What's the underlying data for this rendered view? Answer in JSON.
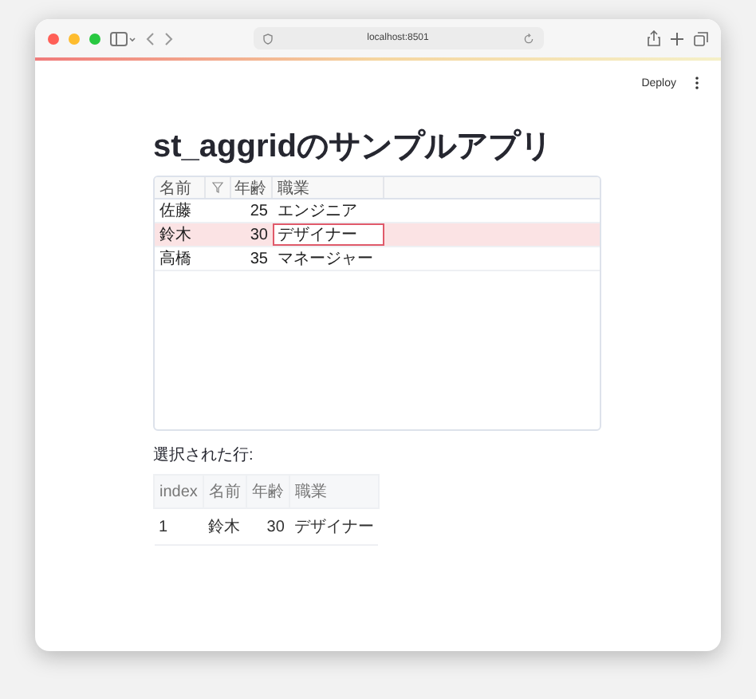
{
  "browser": {
    "url": "localhost:8501"
  },
  "header": {
    "deploy": "Deploy"
  },
  "title": "st_aggridのサンプルアプリ",
  "grid": {
    "columns": [
      "名前",
      "年齢",
      "職業"
    ],
    "rows": [
      {
        "name": "佐藤",
        "age": "25",
        "job": "エンジニア",
        "selected": false,
        "focused": false
      },
      {
        "name": "鈴木",
        "age": "30",
        "job": "デザイナー",
        "selected": true,
        "focused": true
      },
      {
        "name": "高橋",
        "age": "35",
        "job": "マネージャー",
        "selected": false,
        "focused": false
      }
    ]
  },
  "selected_label": "選択された行:",
  "result_table": {
    "columns": [
      "index",
      "名前",
      "年齢",
      "職業"
    ],
    "rows": [
      [
        "1",
        "鈴木",
        "30",
        "デザイナー"
      ]
    ]
  }
}
